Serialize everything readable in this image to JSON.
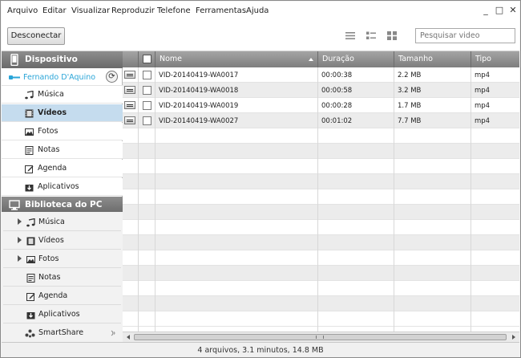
{
  "menu": [
    "Arquivo",
    "Editar",
    "Visualizar",
    "Reproduzir",
    "Telefone",
    "Ferramentas",
    "Ajuda"
  ],
  "window_controls": {
    "minimize": "_",
    "maximize": "□",
    "close": "✕"
  },
  "toolbar": {
    "disconnect_label": "Desconectar",
    "search_placeholder": "Pesquisar video"
  },
  "sidebar": {
    "device_header": "Dispositivo",
    "device_name": "Fernando D'Aquino",
    "device_items": [
      {
        "label": "Música",
        "icon": "music-note-icon",
        "selected": false
      },
      {
        "label": "Vídeos",
        "icon": "film-icon",
        "selected": true
      },
      {
        "label": "Fotos",
        "icon": "photo-icon",
        "selected": false
      },
      {
        "label": "Notas",
        "icon": "note-icon",
        "selected": false
      },
      {
        "label": "Agenda",
        "icon": "calendar-edit-icon",
        "selected": false
      },
      {
        "label": "Aplicativos",
        "icon": "app-download-icon",
        "selected": false
      }
    ],
    "pc_header": "Biblioteca do PC",
    "pc_items": [
      {
        "label": "Música",
        "icon": "music-note-icon",
        "expandable": true
      },
      {
        "label": "Vídeos",
        "icon": "film-icon",
        "expandable": true
      },
      {
        "label": "Fotos",
        "icon": "photo-icon",
        "expandable": true
      },
      {
        "label": "Notas",
        "icon": "note-icon",
        "expandable": false
      },
      {
        "label": "Agenda",
        "icon": "calendar-edit-icon",
        "expandable": false
      },
      {
        "label": "Aplicativos",
        "icon": "app-download-icon",
        "expandable": false
      },
      {
        "label": "SmartShare",
        "icon": "smartshare-icon",
        "expandable": false
      }
    ]
  },
  "table": {
    "columns": [
      "Nome",
      "Duração",
      "Tamanho",
      "Tipo"
    ],
    "rows": [
      [
        "VID-20140419-WA0017",
        "00:00:38",
        "2.2 MB",
        "mp4"
      ],
      [
        "VID-20140419-WA0018",
        "00:00:58",
        "3.2 MB",
        "mp4"
      ],
      [
        "VID-20140419-WA0019",
        "00:00:28",
        "1.7 MB",
        "mp4"
      ],
      [
        "VID-20140419-WA0027",
        "00:01:02",
        "7.7 MB",
        "mp4"
      ]
    ]
  },
  "status": "4 arquivos, 3.1 minutos, 14.8 MB",
  "colors": {
    "accent": "#2aa5d8",
    "selected_row": "#c5dcee",
    "header_gray": "#7e7e7e"
  }
}
